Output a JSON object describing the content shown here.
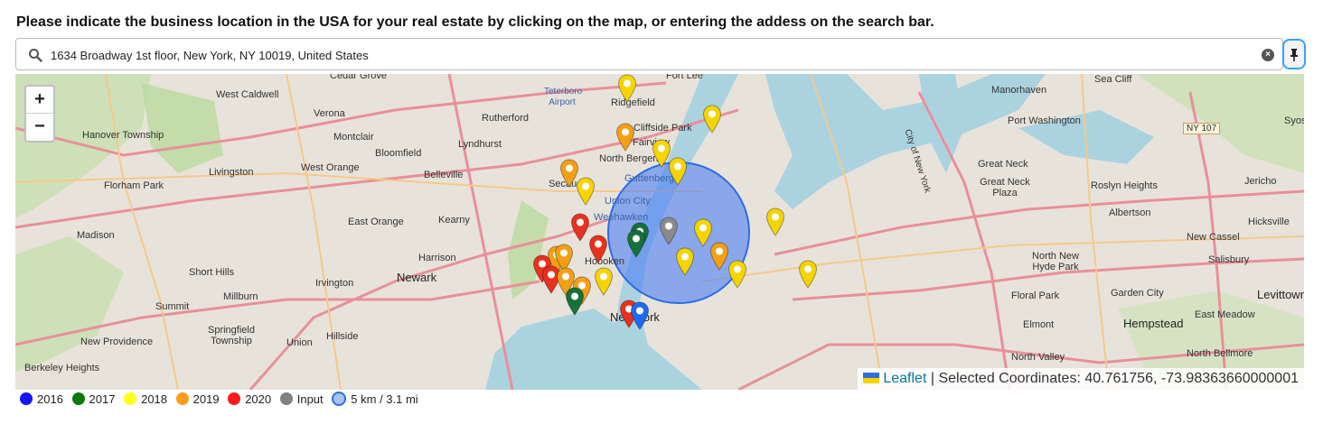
{
  "prompt": "Please indicate the business location in the USA for your real estate by clicking on the map, or entering the addess on the search bar.",
  "search": {
    "value": "1634 Broadway 1st floor, New York, NY 10019, United States",
    "icon": "search-icon"
  },
  "pin_button": {
    "icon": "pin-icon"
  },
  "zoom": {
    "in": "+",
    "out": "−"
  },
  "map_labels": [
    "Cedar Grove",
    "Fort Lee",
    "Sea Cliff",
    "Manorhaven",
    "Teterboro Airport",
    "Ridgefield",
    "West Caldwell",
    "Verona",
    "Rutherford",
    "Cliffside Park",
    "Port Washington",
    "Hanover Township",
    "Montclair",
    "Lyndhurst",
    "Fairview",
    "Bloomfield",
    "North Bergen",
    "Syosset",
    "NY 107",
    "Livingston",
    "West Orange",
    "Belleville",
    "Secaucus",
    "Guttenberg",
    "Great Neck",
    "Florham Park",
    "Union City",
    "Great Neck Plaza",
    "Roslyn Heights",
    "Jericho",
    "Weehawken",
    "Kearny",
    "East Orange",
    "Albertson",
    "Hicksville",
    "Madison",
    "New Cassel",
    "Harrison",
    "Hoboken",
    "North New Hyde Park",
    "Salisbury",
    "Short Hills",
    "Newark",
    "Irvington",
    "Floral Park",
    "Garden City",
    "Levittown",
    "Millburn",
    "Summit",
    "New York",
    "Elmont",
    "Hempstead",
    "East Meadow",
    "Springfield Township",
    "New Providence",
    "Union",
    "Hillside",
    "Berkeley Heights",
    "North Valley",
    "North Bellmore",
    "City of New York"
  ],
  "attribution": {
    "link": "Leaflet",
    "separator": "|",
    "coordinates": "Selected Coordinates: 40.761756, -73.98363660000001"
  },
  "legend": [
    {
      "label": "2016",
      "color": "#1414ff"
    },
    {
      "label": "2017",
      "color": "#0a7a0a"
    },
    {
      "label": "2018",
      "color": "#ffff1a"
    },
    {
      "label": "2019",
      "color": "#ff9a1a"
    },
    {
      "label": "2020",
      "color": "#ff1a1a"
    },
    {
      "label": "Input",
      "color": "#808080"
    },
    {
      "label": "5 km / 3.1 mi",
      "color": "#2a6de6"
    }
  ],
  "markers": [
    {
      "year": "2018",
      "color": "#f5d400"
    },
    {
      "year": "2018",
      "color": "#f5d400"
    },
    {
      "year": "2019",
      "color": "#f59f14"
    },
    {
      "year": "2018",
      "color": "#f5d400"
    },
    {
      "year": "2018",
      "color": "#f5d400"
    },
    {
      "year": "2019",
      "color": "#f59f14"
    },
    {
      "year": "2018",
      "color": "#f5d400"
    },
    {
      "year": "2020",
      "color": "#e8321e"
    },
    {
      "year": "Input",
      "color": "#8a8a8a"
    },
    {
      "year": "2018",
      "color": "#f5d400"
    },
    {
      "year": "2018",
      "color": "#f5d400"
    },
    {
      "year": "2017",
      "color": "#16723a"
    },
    {
      "year": "2017",
      "color": "#16723a"
    },
    {
      "year": "2019",
      "color": "#f59f14"
    },
    {
      "year": "2019",
      "color": "#f59f14"
    },
    {
      "year": "2020",
      "color": "#e8321e"
    },
    {
      "year": "2020",
      "color": "#e8321e"
    },
    {
      "year": "2020",
      "color": "#e8321e"
    },
    {
      "year": "2019",
      "color": "#f59f14"
    },
    {
      "year": "2018",
      "color": "#f5d400"
    },
    {
      "year": "2018",
      "color": "#f5d400"
    },
    {
      "year": "2018",
      "color": "#f5d400"
    },
    {
      "year": "2019",
      "color": "#f59f14"
    },
    {
      "year": "2018",
      "color": "#f5d400"
    },
    {
      "year": "2019",
      "color": "#f59f14"
    },
    {
      "year": "2017",
      "color": "#16723a"
    },
    {
      "year": "2020",
      "color": "#e8321e"
    },
    {
      "year": "2016",
      "color": "#1e6bf0"
    }
  ]
}
